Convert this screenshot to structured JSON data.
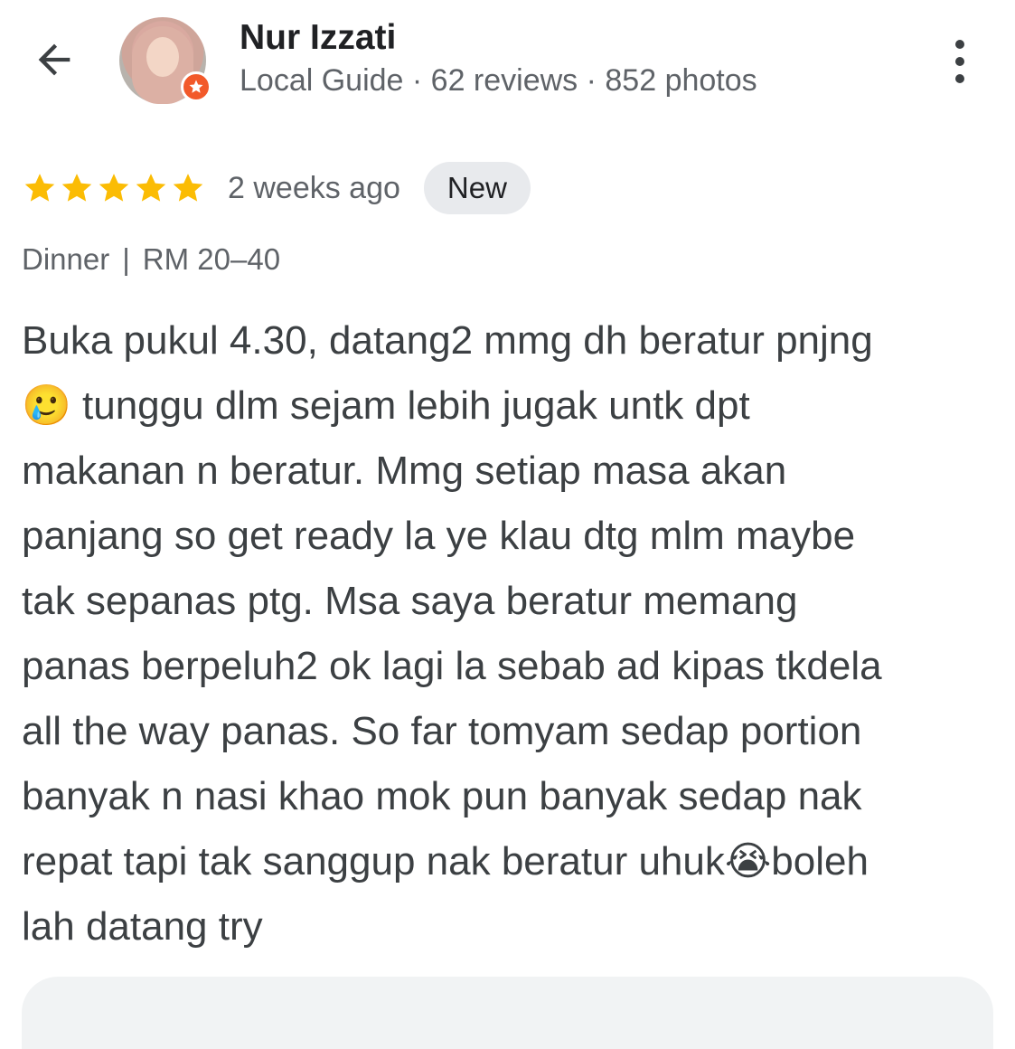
{
  "header": {
    "back_icon": "arrow-back-icon",
    "author_name": "Nur Izzati",
    "author_meta": "Local Guide · 62 reviews · 852 photos",
    "badge_icon": "local-guide-badge-icon",
    "more_icon": "more-vert-icon"
  },
  "review": {
    "rating": 5,
    "rating_max": 5,
    "time_ago": "2 weeks ago",
    "badge": "New",
    "meal_type": "Dinner",
    "separator": "|",
    "price_range": "RM 20–40",
    "text": "Buka pukul 4.30, datang2 mmg dh beratur pnjng\n🥲 tunggu dlm sejam lebih jugak untk dpt\nmakanan n beratur. Mmg setiap masa akan\npanjang so get ready la ye klau dtg mlm maybe\ntak sepanas ptg. Msa saya beratur memang\npanas berpeluh2 ok lagi la sebab ad kipas tkdela\nall the way panas. So far tomyam sedap portion\nbanyak n nasi khao mok pun banyak sedap nak\nrepat tapi tak sanggup nak beratur uhuk😭boleh\nlah datang try"
  },
  "colors": {
    "star": "#fbbc04",
    "text_primary": "#202124",
    "text_secondary": "#5f6368",
    "chip_bg": "#e8eaed",
    "badge": "#f2592a"
  }
}
